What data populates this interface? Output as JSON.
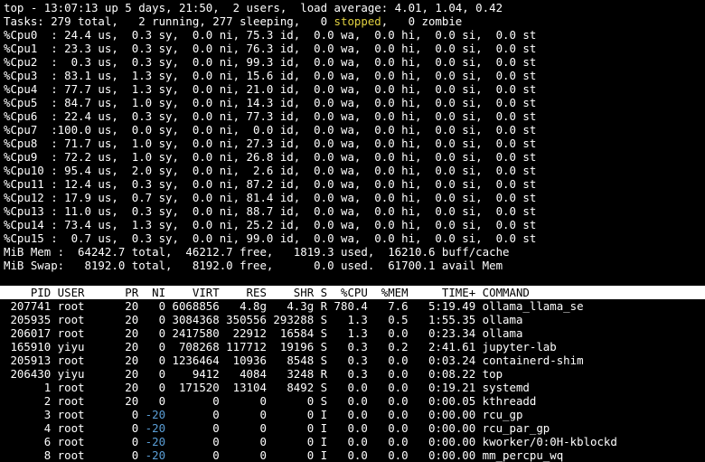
{
  "summary": {
    "line1": "top - 13:07:13 up 5 days, 21:50,  2 users,  load average: 4.01, 1.04, 0.42",
    "tasks_pre": "Tasks: 279 total,   2 running, 277 sleeping,   0 ",
    "tasks_stopped": "stopped",
    "tasks_post": ",   0 zombie"
  },
  "cpus": [
    "%Cpu0  : 24.4 us,  0.3 sy,  0.0 ni, 75.3 id,  0.0 wa,  0.0 hi,  0.0 si,  0.0 st",
    "%Cpu1  : 23.3 us,  0.3 sy,  0.0 ni, 76.3 id,  0.0 wa,  0.0 hi,  0.0 si,  0.0 st",
    "%Cpu2  :  0.3 us,  0.3 sy,  0.0 ni, 99.3 id,  0.0 wa,  0.0 hi,  0.0 si,  0.0 st",
    "%Cpu3  : 83.1 us,  1.3 sy,  0.0 ni, 15.6 id,  0.0 wa,  0.0 hi,  0.0 si,  0.0 st",
    "%Cpu4  : 77.7 us,  1.3 sy,  0.0 ni, 21.0 id,  0.0 wa,  0.0 hi,  0.0 si,  0.0 st",
    "%Cpu5  : 84.7 us,  1.0 sy,  0.0 ni, 14.3 id,  0.0 wa,  0.0 hi,  0.0 si,  0.0 st",
    "%Cpu6  : 22.4 us,  0.3 sy,  0.0 ni, 77.3 id,  0.0 wa,  0.0 hi,  0.0 si,  0.0 st",
    "%Cpu7  :100.0 us,  0.0 sy,  0.0 ni,  0.0 id,  0.0 wa,  0.0 hi,  0.0 si,  0.0 st",
    "%Cpu8  : 71.7 us,  1.0 sy,  0.0 ni, 27.3 id,  0.0 wa,  0.0 hi,  0.0 si,  0.0 st",
    "%Cpu9  : 72.2 us,  1.0 sy,  0.0 ni, 26.8 id,  0.0 wa,  0.0 hi,  0.0 si,  0.0 st",
    "%Cpu10 : 95.4 us,  2.0 sy,  0.0 ni,  2.6 id,  0.0 wa,  0.0 hi,  0.0 si,  0.0 st",
    "%Cpu11 : 12.4 us,  0.3 sy,  0.0 ni, 87.2 id,  0.0 wa,  0.0 hi,  0.0 si,  0.0 st",
    "%Cpu12 : 17.9 us,  0.7 sy,  0.0 ni, 81.4 id,  0.0 wa,  0.0 hi,  0.0 si,  0.0 st",
    "%Cpu13 : 11.0 us,  0.3 sy,  0.0 ni, 88.7 id,  0.0 wa,  0.0 hi,  0.0 si,  0.0 st",
    "%Cpu14 : 73.4 us,  1.3 sy,  0.0 ni, 25.2 id,  0.0 wa,  0.0 hi,  0.0 si,  0.0 st",
    "%Cpu15 :  0.7 us,  0.3 sy,  0.0 ni, 99.0 id,  0.0 wa,  0.0 hi,  0.0 si,  0.0 st"
  ],
  "memory": {
    "mem": "MiB Mem :  64242.7 total,  46212.7 free,   1819.3 used,  16210.6 buff/cache",
    "swap": "MiB Swap:   8192.0 total,   8192.0 free,      0.0 used.  61700.1 avail Mem"
  },
  "table": {
    "header": "    PID USER      PR  NI    VIRT    RES    SHR S  %CPU  %MEM     TIME+ COMMAND",
    "rows": [
      {
        "pre": " 207741 root      20   0 ",
        "ni": "",
        "post": "6068856   4.8g   4.3g R 780.4   7.6   5:19.49 ollama_llama_se"
      },
      {
        "pre": " 205935 root      20   0 ",
        "ni": "",
        "post": "3084368 350556 293288 S   1.3   0.5   1:55.35 ollama"
      },
      {
        "pre": " 206017 root      20   0 ",
        "ni": "",
        "post": "2417580  22912  16584 S   1.3   0.0   0:23.34 ollama"
      },
      {
        "pre": " 165910 yiyu      20   0 ",
        "ni": "",
        "post": " 708268 117712  19196 S   0.3   0.2   2:41.61 jupyter-lab"
      },
      {
        "pre": " 205913 root      20   0 ",
        "ni": "",
        "post": "1236464  10936   8548 S   0.3   0.0   0:03.24 containerd-shim"
      },
      {
        "pre": " 206430 yiyu      20   0 ",
        "ni": "",
        "post": "   9412   4084   3248 R   0.3   0.0   0:08.22 top"
      },
      {
        "pre": "      1 root      20   0 ",
        "ni": "",
        "post": " 171520  13104   8492 S   0.0   0.0   0:19.21 systemd"
      },
      {
        "pre": "      2 root      20   0 ",
        "ni": "",
        "post": "      0      0      0 S   0.0   0.0   0:00.05 kthreadd"
      },
      {
        "pre": "      3 root       0 ",
        "ni": "-20",
        "post": "       0      0      0 I   0.0   0.0   0:00.00 rcu_gp"
      },
      {
        "pre": "      4 root       0 ",
        "ni": "-20",
        "post": "       0      0      0 I   0.0   0.0   0:00.00 rcu_par_gp"
      },
      {
        "pre": "      6 root       0 ",
        "ni": "-20",
        "post": "       0      0      0 I   0.0   0.0   0:00.00 kworker/0:0H-kblockd"
      },
      {
        "pre": "      8 root       0 ",
        "ni": "-20",
        "post": "       0      0      0 I   0.0   0.0   0:00.00 mm_percpu_wq"
      }
    ]
  },
  "colors": {
    "background": "#000000",
    "foreground": "#ffffff",
    "header_bg": "#ffffff",
    "stopped": "#e0d040",
    "negative_nice": "#5a9ed6"
  }
}
